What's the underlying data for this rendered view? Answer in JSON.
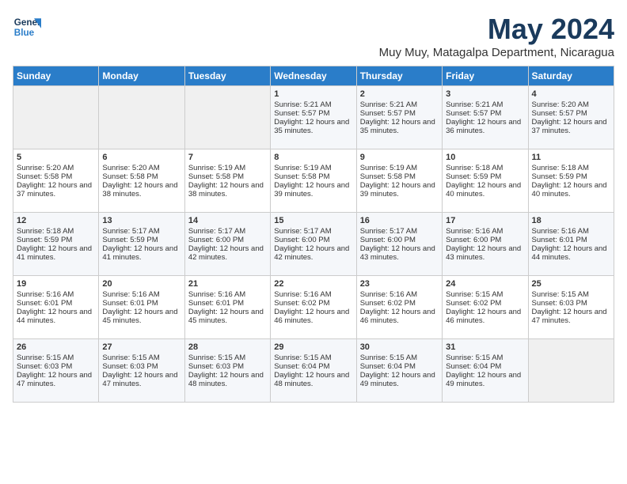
{
  "logo": {
    "line1": "General",
    "line2": "Blue"
  },
  "title": "May 2024",
  "subtitle": "Muy Muy, Matagalpa Department, Nicaragua",
  "weekdays": [
    "Sunday",
    "Monday",
    "Tuesday",
    "Wednesday",
    "Thursday",
    "Friday",
    "Saturday"
  ],
  "weeks": [
    [
      {
        "day": "",
        "sunrise": "",
        "sunset": "",
        "daylight": ""
      },
      {
        "day": "",
        "sunrise": "",
        "sunset": "",
        "daylight": ""
      },
      {
        "day": "",
        "sunrise": "",
        "sunset": "",
        "daylight": ""
      },
      {
        "day": "1",
        "sunrise": "Sunrise: 5:21 AM",
        "sunset": "Sunset: 5:57 PM",
        "daylight": "Daylight: 12 hours and 35 minutes."
      },
      {
        "day": "2",
        "sunrise": "Sunrise: 5:21 AM",
        "sunset": "Sunset: 5:57 PM",
        "daylight": "Daylight: 12 hours and 35 minutes."
      },
      {
        "day": "3",
        "sunrise": "Sunrise: 5:21 AM",
        "sunset": "Sunset: 5:57 PM",
        "daylight": "Daylight: 12 hours and 36 minutes."
      },
      {
        "day": "4",
        "sunrise": "Sunrise: 5:20 AM",
        "sunset": "Sunset: 5:57 PM",
        "daylight": "Daylight: 12 hours and 37 minutes."
      }
    ],
    [
      {
        "day": "5",
        "sunrise": "Sunrise: 5:20 AM",
        "sunset": "Sunset: 5:58 PM",
        "daylight": "Daylight: 12 hours and 37 minutes."
      },
      {
        "day": "6",
        "sunrise": "Sunrise: 5:20 AM",
        "sunset": "Sunset: 5:58 PM",
        "daylight": "Daylight: 12 hours and 38 minutes."
      },
      {
        "day": "7",
        "sunrise": "Sunrise: 5:19 AM",
        "sunset": "Sunset: 5:58 PM",
        "daylight": "Daylight: 12 hours and 38 minutes."
      },
      {
        "day": "8",
        "sunrise": "Sunrise: 5:19 AM",
        "sunset": "Sunset: 5:58 PM",
        "daylight": "Daylight: 12 hours and 39 minutes."
      },
      {
        "day": "9",
        "sunrise": "Sunrise: 5:19 AM",
        "sunset": "Sunset: 5:58 PM",
        "daylight": "Daylight: 12 hours and 39 minutes."
      },
      {
        "day": "10",
        "sunrise": "Sunrise: 5:18 AM",
        "sunset": "Sunset: 5:59 PM",
        "daylight": "Daylight: 12 hours and 40 minutes."
      },
      {
        "day": "11",
        "sunrise": "Sunrise: 5:18 AM",
        "sunset": "Sunset: 5:59 PM",
        "daylight": "Daylight: 12 hours and 40 minutes."
      }
    ],
    [
      {
        "day": "12",
        "sunrise": "Sunrise: 5:18 AM",
        "sunset": "Sunset: 5:59 PM",
        "daylight": "Daylight: 12 hours and 41 minutes."
      },
      {
        "day": "13",
        "sunrise": "Sunrise: 5:17 AM",
        "sunset": "Sunset: 5:59 PM",
        "daylight": "Daylight: 12 hours and 41 minutes."
      },
      {
        "day": "14",
        "sunrise": "Sunrise: 5:17 AM",
        "sunset": "Sunset: 6:00 PM",
        "daylight": "Daylight: 12 hours and 42 minutes."
      },
      {
        "day": "15",
        "sunrise": "Sunrise: 5:17 AM",
        "sunset": "Sunset: 6:00 PM",
        "daylight": "Daylight: 12 hours and 42 minutes."
      },
      {
        "day": "16",
        "sunrise": "Sunrise: 5:17 AM",
        "sunset": "Sunset: 6:00 PM",
        "daylight": "Daylight: 12 hours and 43 minutes."
      },
      {
        "day": "17",
        "sunrise": "Sunrise: 5:16 AM",
        "sunset": "Sunset: 6:00 PM",
        "daylight": "Daylight: 12 hours and 43 minutes."
      },
      {
        "day": "18",
        "sunrise": "Sunrise: 5:16 AM",
        "sunset": "Sunset: 6:01 PM",
        "daylight": "Daylight: 12 hours and 44 minutes."
      }
    ],
    [
      {
        "day": "19",
        "sunrise": "Sunrise: 5:16 AM",
        "sunset": "Sunset: 6:01 PM",
        "daylight": "Daylight: 12 hours and 44 minutes."
      },
      {
        "day": "20",
        "sunrise": "Sunrise: 5:16 AM",
        "sunset": "Sunset: 6:01 PM",
        "daylight": "Daylight: 12 hours and 45 minutes."
      },
      {
        "day": "21",
        "sunrise": "Sunrise: 5:16 AM",
        "sunset": "Sunset: 6:01 PM",
        "daylight": "Daylight: 12 hours and 45 minutes."
      },
      {
        "day": "22",
        "sunrise": "Sunrise: 5:16 AM",
        "sunset": "Sunset: 6:02 PM",
        "daylight": "Daylight: 12 hours and 46 minutes."
      },
      {
        "day": "23",
        "sunrise": "Sunrise: 5:16 AM",
        "sunset": "Sunset: 6:02 PM",
        "daylight": "Daylight: 12 hours and 46 minutes."
      },
      {
        "day": "24",
        "sunrise": "Sunrise: 5:15 AM",
        "sunset": "Sunset: 6:02 PM",
        "daylight": "Daylight: 12 hours and 46 minutes."
      },
      {
        "day": "25",
        "sunrise": "Sunrise: 5:15 AM",
        "sunset": "Sunset: 6:03 PM",
        "daylight": "Daylight: 12 hours and 47 minutes."
      }
    ],
    [
      {
        "day": "26",
        "sunrise": "Sunrise: 5:15 AM",
        "sunset": "Sunset: 6:03 PM",
        "daylight": "Daylight: 12 hours and 47 minutes."
      },
      {
        "day": "27",
        "sunrise": "Sunrise: 5:15 AM",
        "sunset": "Sunset: 6:03 PM",
        "daylight": "Daylight: 12 hours and 47 minutes."
      },
      {
        "day": "28",
        "sunrise": "Sunrise: 5:15 AM",
        "sunset": "Sunset: 6:03 PM",
        "daylight": "Daylight: 12 hours and 48 minutes."
      },
      {
        "day": "29",
        "sunrise": "Sunrise: 5:15 AM",
        "sunset": "Sunset: 6:04 PM",
        "daylight": "Daylight: 12 hours and 48 minutes."
      },
      {
        "day": "30",
        "sunrise": "Sunrise: 5:15 AM",
        "sunset": "Sunset: 6:04 PM",
        "daylight": "Daylight: 12 hours and 49 minutes."
      },
      {
        "day": "31",
        "sunrise": "Sunrise: 5:15 AM",
        "sunset": "Sunset: 6:04 PM",
        "daylight": "Daylight: 12 hours and 49 minutes."
      },
      {
        "day": "",
        "sunrise": "",
        "sunset": "",
        "daylight": ""
      }
    ]
  ]
}
